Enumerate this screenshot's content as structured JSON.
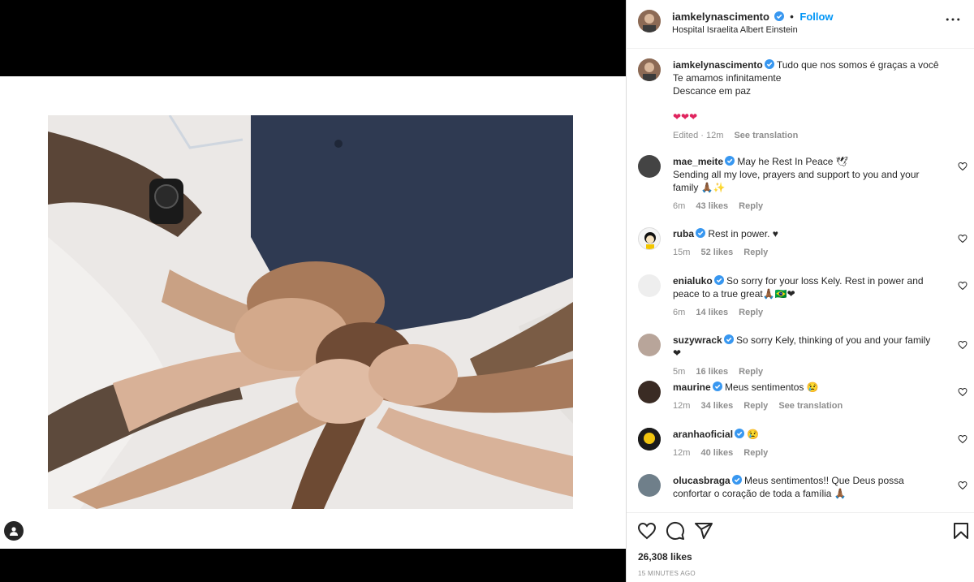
{
  "post": {
    "username": "iamkelynascimento",
    "follow_label": "Follow",
    "location": "Hospital Israelita Albert Einstein",
    "caption_line1": "Tudo que nos somos é graças a você",
    "caption_line2": "Te amamos infinitamente",
    "caption_line3": "Descance em paz",
    "caption_hearts": "❤❤❤",
    "caption_edited": "Edited · 12m",
    "see_translation": "See translation",
    "likes": "26,308 likes",
    "time_ago": "15 MINUTES AGO"
  },
  "comments": [
    {
      "user": "mae_meite",
      "text": "May he Rest In Peace 🕊",
      "text2": "Sending all my love, prayers and support to you and your family 🙏🏾✨",
      "time": "6m",
      "likes": "43 likes",
      "reply": "Reply",
      "translate": ""
    },
    {
      "user": "ruba",
      "text": "Rest in power. ♥",
      "text2": "",
      "time": "15m",
      "likes": "52 likes",
      "reply": "Reply",
      "translate": ""
    },
    {
      "user": "enialuko",
      "text": "So sorry for your loss Kely. Rest in power and peace to a true great🙏🏾🇧🇷❤",
      "text2": "",
      "time": "6m",
      "likes": "14 likes",
      "reply": "Reply",
      "translate": ""
    },
    {
      "user": "suzywrack",
      "text": "So sorry Kely, thinking of you and your family ❤",
      "text2": "",
      "time": "5m",
      "likes": "16 likes",
      "reply": "Reply",
      "translate": ""
    },
    {
      "user": "maurine",
      "text": "Meus sentimentos 😢",
      "text2": "",
      "time": "12m",
      "likes": "34 likes",
      "reply": "Reply",
      "translate": "See translation"
    },
    {
      "user": "aranhaoficial",
      "text": "😢",
      "text2": "",
      "time": "12m",
      "likes": "40 likes",
      "reply": "Reply",
      "translate": ""
    },
    {
      "user": "olucasbraga",
      "text": "Meus sentimentos!! Que Deus possa confortar o coração de toda a família 🙏🏾",
      "text2": "",
      "time": "",
      "likes": "",
      "reply": "",
      "translate": ""
    }
  ],
  "icons": {
    "verified": "verified-badge-icon",
    "more": "more-options-icon",
    "like": "heart-icon",
    "comment": "comment-icon",
    "share": "share-icon",
    "save": "bookmark-icon",
    "tag": "user-tag-icon"
  },
  "colors": {
    "accent": "#0095f6",
    "verified": "#3897f0",
    "text": "#262626",
    "muted": "#8e8e8e"
  }
}
